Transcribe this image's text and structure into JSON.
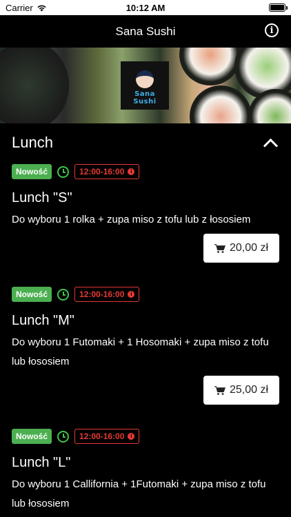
{
  "status_bar": {
    "carrier": "Carrier",
    "time": "10:12 AM"
  },
  "nav": {
    "title": "Sana Sushi"
  },
  "banner": {
    "logo_text_1": "Sana",
    "logo_text_2": "Sushi"
  },
  "section": {
    "title": "Lunch"
  },
  "items": [
    {
      "badge": "Nowość",
      "hours": "12:00-16:00",
      "name": "Lunch \"S\"",
      "description": "Do wyboru 1 rolka + zupa miso z tofu lub z łososiem",
      "price": "20,00 zł"
    },
    {
      "badge": "Nowość",
      "hours": "12:00-16:00",
      "name": "Lunch \"M\"",
      "description": "Do wyboru 1 Futomaki + 1 Hosomaki + zupa miso z tofu lub łososiem",
      "price": "25,00 zł"
    },
    {
      "badge": "Nowość",
      "hours": "12:00-16:00",
      "name": "Lunch \"L\"",
      "description": "Do wyboru 1 Callifornia + 1Futomaki + zupa miso z tofu lub łososiem",
      "price": ""
    }
  ],
  "colors": {
    "accent_green": "#4caf50",
    "hours_red": "#e53935",
    "background": "#000000"
  }
}
